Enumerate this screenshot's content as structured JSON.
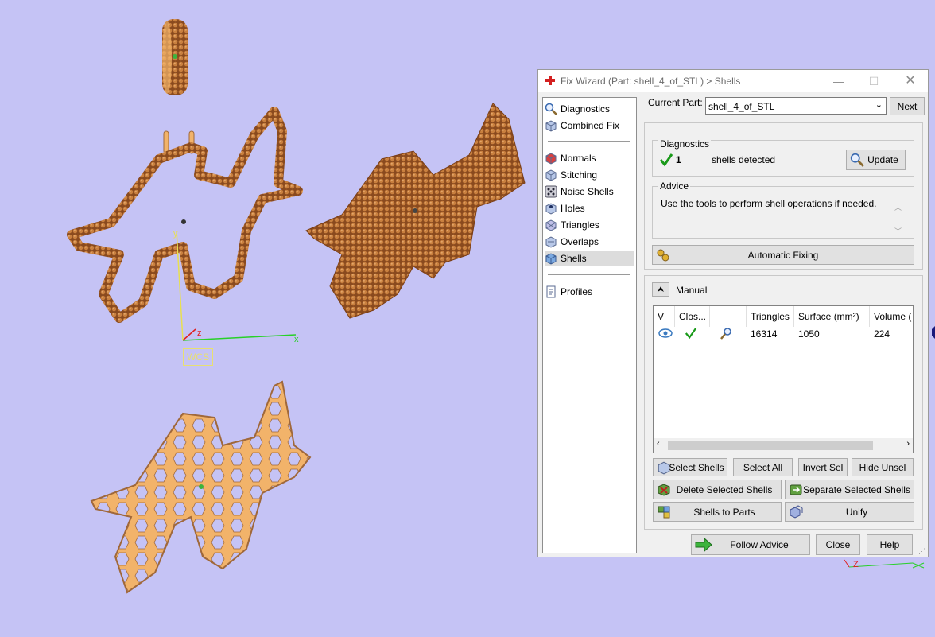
{
  "viewport": {
    "wcs_label": "WCS",
    "axis_x": "x",
    "axis_y": "y",
    "axis_z": "z",
    "mini_axis_z": "Z"
  },
  "dialog": {
    "title": "Fix Wizard (Part: shell_4_of_STL) > Shells",
    "nav_top": [
      {
        "label": "Diagnostics",
        "icon": "magnifier-icon"
      },
      {
        "label": "Combined Fix",
        "icon": "cube-icon"
      }
    ],
    "nav_tools": [
      {
        "label": "Normals",
        "icon": "cube-red-icon"
      },
      {
        "label": "Stitching",
        "icon": "cube-icon"
      },
      {
        "label": "Noise Shells",
        "icon": "dice-icon"
      },
      {
        "label": "Holes",
        "icon": "cube-hole-icon"
      },
      {
        "label": "Triangles",
        "icon": "triangles-icon"
      },
      {
        "label": "Overlaps",
        "icon": "overlap-icon"
      },
      {
        "label": "Shells",
        "icon": "shell-cube-icon"
      }
    ],
    "nav_profiles": {
      "label": "Profiles",
      "icon": "profile-doc-icon"
    },
    "selected_nav": "Shells",
    "current_part_label": "Current Part:",
    "current_part_value": "shell_4_of_STL",
    "next_label": "Next",
    "diagnostics_group": "Diagnostics",
    "diag_count": "1",
    "diag_text": "shells detected",
    "update_label": "Update",
    "advice_group": "Advice",
    "advice_text": "Use the tools to perform shell operations if needed.",
    "automatic_fixing_label": "Automatic Fixing",
    "manual_label": "Manual",
    "table": {
      "headers": [
        "V",
        "Clos...",
        "",
        "Triangles",
        "Surface (mm²)",
        "Volume ("
      ],
      "rows": [
        {
          "visible": "eye-icon",
          "closed": "check-icon",
          "action": "magnifier-icon",
          "triangles": "16314",
          "surface": "1050",
          "volume": "224"
        }
      ]
    },
    "buttons": {
      "select_shells": "Select Shells",
      "select_all": "Select All",
      "invert_sel": "Invert Sel",
      "hide_unsel": "Hide Unsel",
      "delete_selected": "Delete Selected Shells",
      "separate_selected": "Separate Selected Shells",
      "shells_to_parts": "Shells to Parts",
      "unify": "Unify",
      "follow_advice": "Follow Advice",
      "close": "Close",
      "help": "Help"
    },
    "colors": {
      "accent_check": "#1a9a1a",
      "follow_arrow": "#3cb43c",
      "title_icon": "#d42020"
    }
  }
}
